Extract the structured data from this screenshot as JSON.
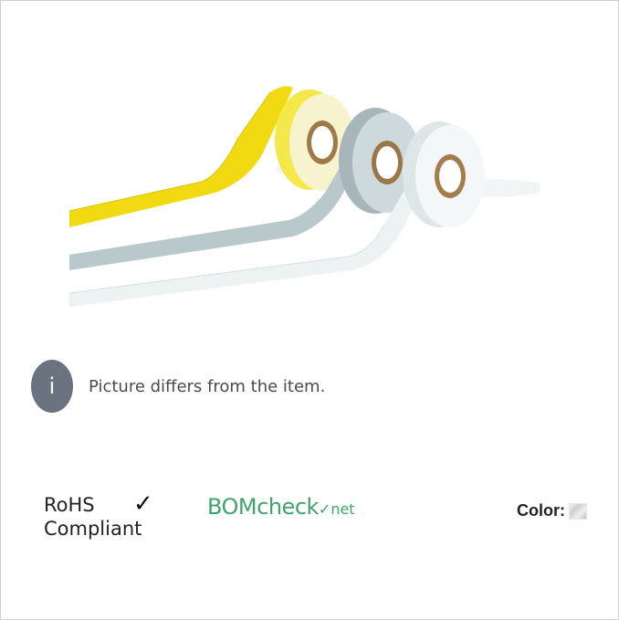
{
  "note": {
    "text": "Picture differs from the item.",
    "icon": "info-icon",
    "icon_glyph": "i"
  },
  "certifications": {
    "rohs": {
      "line1": "RoHS",
      "line2": "Compliant",
      "check": "✓"
    },
    "bomcheck": {
      "part1": "BOM",
      "part2": "check",
      "part3": "✓",
      "part4": "net"
    }
  },
  "color": {
    "label": "Color:",
    "swatch": "grey-metallic"
  },
  "colors": {
    "icon_bg": "#6b7280",
    "bom_green": "#3da56a",
    "tape_yellow": "#f6e02a",
    "tape_grey": "#b8c6c9",
    "tape_white": "#eef3f4"
  }
}
